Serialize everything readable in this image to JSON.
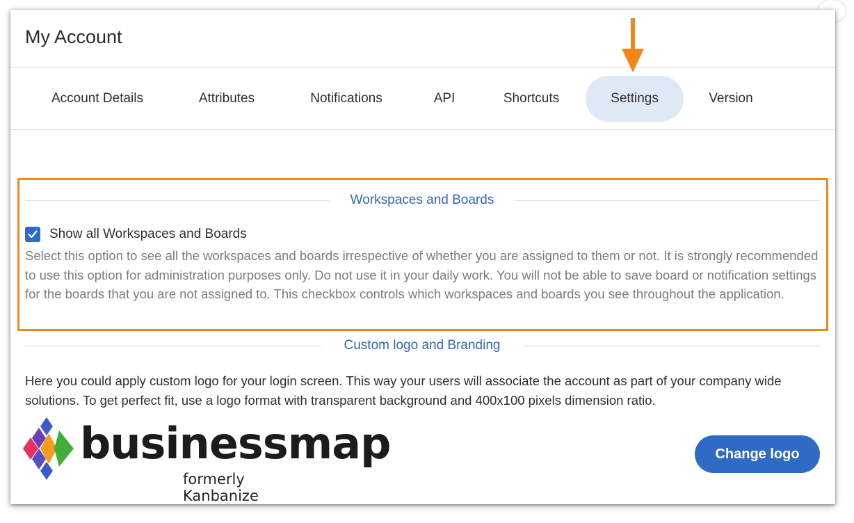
{
  "dialog": {
    "title": "My Account"
  },
  "tabs": [
    {
      "label": "Account Details"
    },
    {
      "label": "Attributes"
    },
    {
      "label": "Notifications"
    },
    {
      "label": "API"
    },
    {
      "label": "Shortcuts"
    },
    {
      "label": "Settings",
      "active": true
    },
    {
      "label": "Version"
    }
  ],
  "workspaces": {
    "heading": "Workspaces and Boards",
    "checkbox_label": "Show all Workspaces and Boards",
    "checked": true,
    "description": "Select this option to see all the workspaces and boards irrespective of whether you are assigned to them or not. It is strongly recommended to use this option for administration purposes only. Do not use it in your daily work. You will not be able to save board or notification settings for the boards that you are not assigned to. This checkbox controls which workspaces and boards you see throughout the application."
  },
  "branding": {
    "heading": "Custom logo and Branding",
    "description": "Here you could apply custom logo for your login screen. This way your users will associate the account as part of your company wide solutions. To get perfect fit, use a logo format with transparent background and 400x100 pixels dimension ratio.",
    "logo_wordmark": "businessmap",
    "logo_tagline": "formerly Kanbanize",
    "change_logo_label": "Change logo"
  },
  "colors": {
    "accent": "#2f6bc4",
    "highlight": "#f28717",
    "active_tab_bg": "#dfe8f5"
  },
  "icons": [
    "arrow-down-icon",
    "checkmark-icon",
    "businessmap-logo-icon"
  ]
}
